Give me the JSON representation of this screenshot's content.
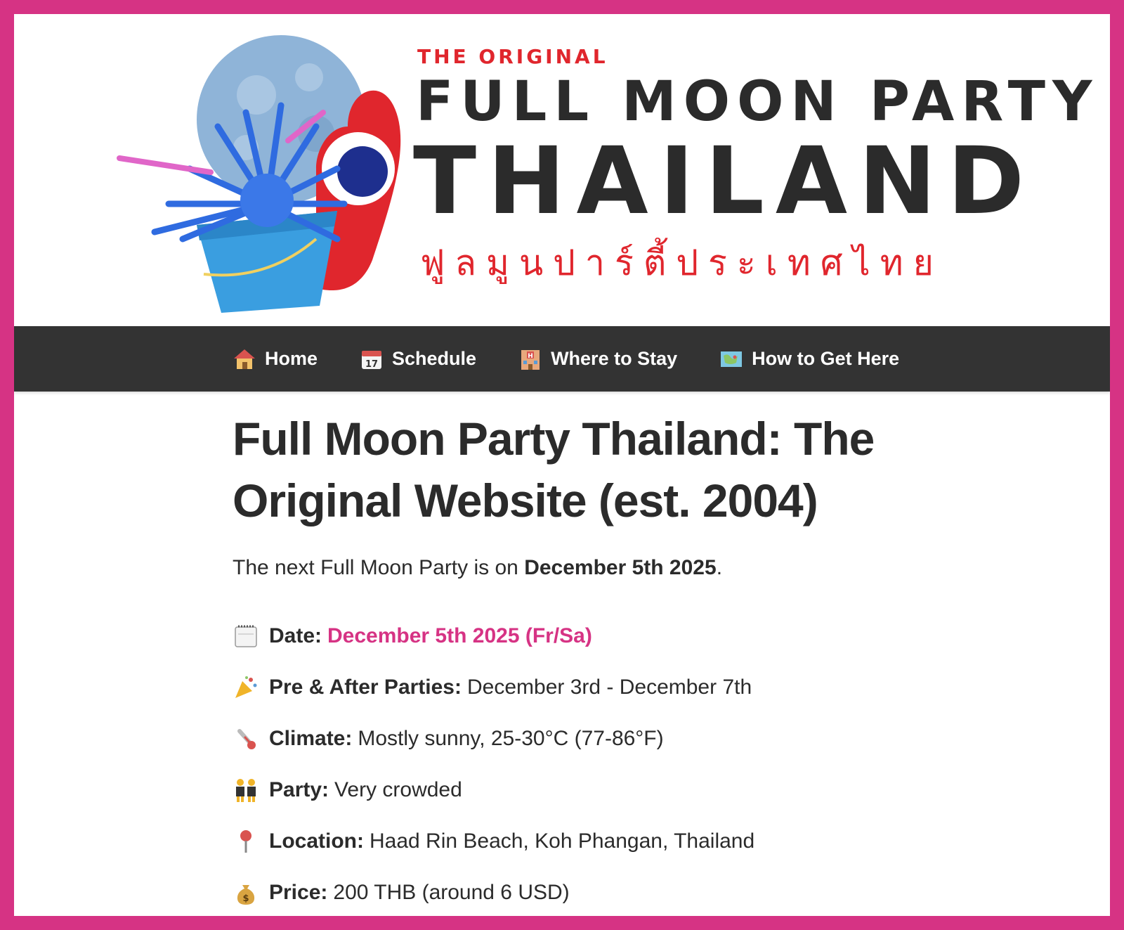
{
  "brand": {
    "top_text": "THE ORIGINAL",
    "line1": "FULL MOON PARTY",
    "line2": "THAILAND",
    "thai": "ฟูลมูนปาร์ตี้ประเทศไทย"
  },
  "nav": {
    "items": [
      {
        "label": "Home",
        "icon": "house-icon"
      },
      {
        "label": "Schedule",
        "icon": "calendar-icon"
      },
      {
        "label": "Where to Stay",
        "icon": "hotel-icon"
      },
      {
        "label": "How to Get Here",
        "icon": "map-icon"
      }
    ]
  },
  "main": {
    "title": "Full Moon Party Thailand: The Original Website (est. 2004)",
    "intro_prefix": "The next Full Moon Party is on ",
    "intro_date": "December 5th 2025",
    "intro_suffix": ".",
    "facts": [
      {
        "icon": "calendar-icon",
        "label": "Date:",
        "value": "December 5th 2025 (Fr/Sa)"
      },
      {
        "icon": "party-popper-icon",
        "label": "Pre & After Parties:",
        "value": "December 3rd - December 7th"
      },
      {
        "icon": "thermometer-icon",
        "label": "Climate:",
        "value": "Mostly sunny, 25-30°C (77-86°F)"
      },
      {
        "icon": "dancers-icon",
        "label": "Party:",
        "value": "Very crowded"
      },
      {
        "icon": "pin-icon",
        "label": "Location:",
        "value": "Haad Rin Beach, Koh Phangan, Thailand"
      },
      {
        "icon": "money-bag-icon",
        "label": "Price:",
        "value": "200 THB (around 6 USD)"
      }
    ]
  },
  "colors": {
    "frame": "#d63384",
    "nav_bg": "#333333",
    "brand_red": "#e0262d",
    "text": "#2b2b2b",
    "accent": "#d63384"
  }
}
